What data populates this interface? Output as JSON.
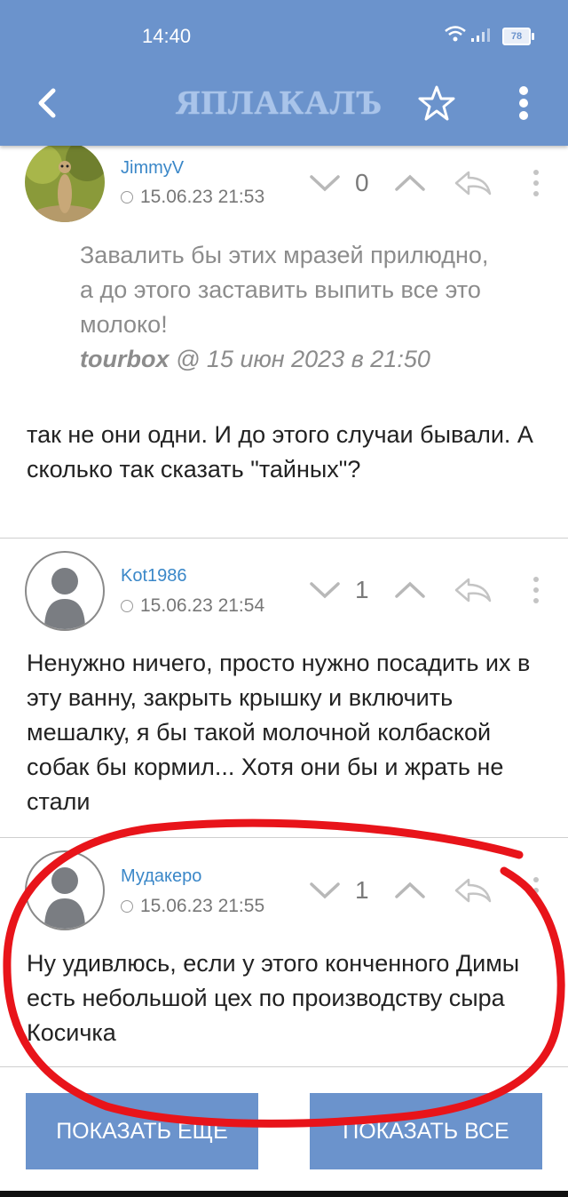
{
  "status_bar": {
    "time": "14:40",
    "battery": "78"
  },
  "header": {
    "logo": "ЯПЛАКАЛЪ",
    "accent_color": "#6b93cc"
  },
  "posts": [
    {
      "author": "JimmyV",
      "date": "15.06.23 21:53",
      "votes": "0",
      "quote": {
        "text": "Завалить бы этих мразей прилюдно, а до этого заставить выпить все это молоко!",
        "author": "tourbox",
        "datetime": "@ 15 июн 2023 в 21:50"
      },
      "text": "так не они одни. И до этого случаи бывали. А сколько так сказать \"тайных\"?"
    },
    {
      "author": "Kot1986",
      "date": "15.06.23 21:54",
      "votes": "1",
      "text": "Ненужно ничего, просто нужно посадить их в эту ванну, закрыть крышку и включить мешалку, я бы такой молочной колбаской собак бы кормил... Хотя они бы и жрать не стали"
    },
    {
      "author": "Мудакеро",
      "date": "15.06.23 21:55",
      "votes": "1",
      "text": "Ну удивлюсь, если у этого конченного Димы есть небольшой цех по производству сыра Косичка"
    }
  ],
  "buttons": {
    "show_more": "ПОКАЗАТЬ ЕЩЕ",
    "show_all": "ПОКАЗАТЬ ВСЕ"
  },
  "icons": [
    "back-arrow-icon",
    "star-icon",
    "more-vert-icon",
    "clock-icon",
    "chevron-down-icon",
    "chevron-up-icon",
    "reply-icon"
  ]
}
